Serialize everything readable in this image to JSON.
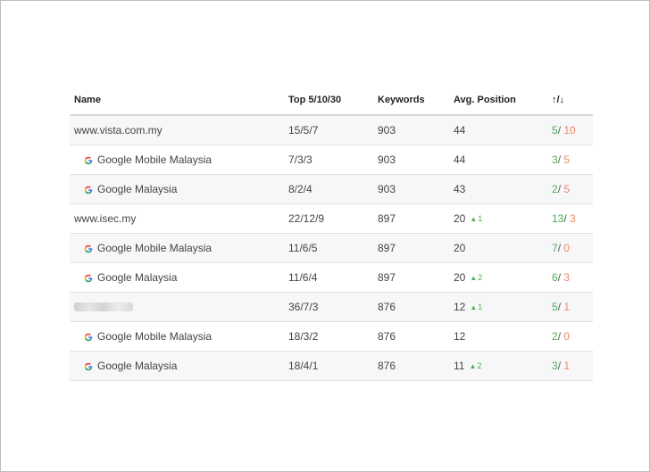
{
  "table": {
    "headers": {
      "name": "Name",
      "top": "Top 5/10/30",
      "keywords": "Keywords",
      "avg": "Avg. Position",
      "updown": "↑/↓"
    },
    "rows": [
      {
        "name": "www.vista.com.my",
        "top": "15/5/7",
        "keywords": "903",
        "avg": "44",
        "delta": "",
        "up": "5",
        "down": "10"
      },
      {
        "name": "Google Mobile Malaysia",
        "icon": "google-mobile-icon",
        "top": "7/3/3",
        "keywords": "903",
        "avg": "44",
        "delta": "",
        "up": "3",
        "down": "5"
      },
      {
        "name": "Google Malaysia",
        "icon": "google-icon",
        "top": "8/2/4",
        "keywords": "903",
        "avg": "43",
        "delta": "",
        "up": "2",
        "down": "5"
      },
      {
        "name": "www.isec.my",
        "top": "22/12/9",
        "keywords": "897",
        "avg": "20",
        "delta": "1",
        "up": "13",
        "down": "3"
      },
      {
        "name": "Google Mobile Malaysia",
        "icon": "google-mobile-icon",
        "top": "11/6/5",
        "keywords": "897",
        "avg": "20",
        "delta": "",
        "up": "7",
        "down": "0"
      },
      {
        "name": "Google Malaysia",
        "icon": "google-icon",
        "top": "11/6/4",
        "keywords": "897",
        "avg": "20",
        "delta": "2",
        "up": "6",
        "down": "3"
      },
      {
        "name": "",
        "top": "36/7/3",
        "keywords": "876",
        "avg": "12",
        "delta": "1",
        "up": "5",
        "down": "1"
      },
      {
        "name": "Google Mobile Malaysia",
        "icon": "google-mobile-icon",
        "top": "18/3/2",
        "keywords": "876",
        "avg": "12",
        "delta": "",
        "up": "2",
        "down": "0"
      },
      {
        "name": "Google Malaysia",
        "icon": "google-icon",
        "top": "18/4/1",
        "keywords": "876",
        "avg": "11",
        "delta": "2",
        "up": "3",
        "down": "1"
      }
    ]
  },
  "colors": {
    "up": "#4caf50",
    "down": "#e8896a"
  }
}
